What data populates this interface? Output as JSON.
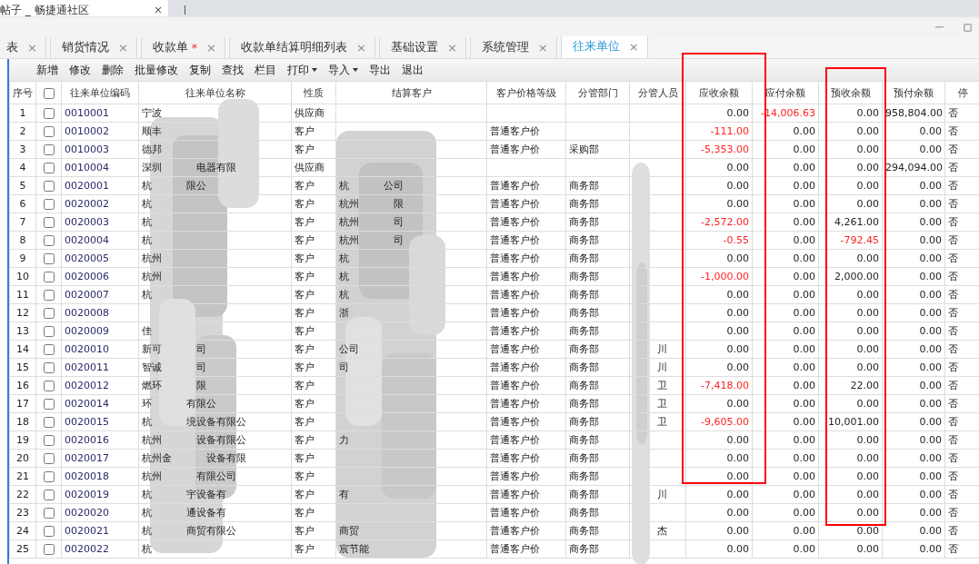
{
  "browser_tab": {
    "title": "帖子 _ 畅捷通社区",
    "close": "×"
  },
  "tabs": [
    {
      "label": "表",
      "selected": false,
      "modified": false
    },
    {
      "label": "销货情况",
      "selected": false,
      "modified": false
    },
    {
      "label": "收款单",
      "selected": false,
      "modified": true
    },
    {
      "label": "收款单结算明细列表",
      "selected": false,
      "modified": false
    },
    {
      "label": "基础设置",
      "selected": false,
      "modified": false
    },
    {
      "label": "系统管理",
      "selected": false,
      "modified": false
    },
    {
      "label": "往来单位",
      "selected": true,
      "modified": false
    }
  ],
  "tab_close": "×",
  "modified_mark": "*",
  "toolbar": [
    {
      "label": "新增",
      "dropdown": false
    },
    {
      "label": "修改",
      "dropdown": false
    },
    {
      "label": "删除",
      "dropdown": false
    },
    {
      "label": "批量修改",
      "dropdown": false
    },
    {
      "label": "复制",
      "dropdown": false
    },
    {
      "label": "查找",
      "dropdown": false
    },
    {
      "label": "栏目",
      "dropdown": false
    },
    {
      "label": "打印",
      "dropdown": true
    },
    {
      "label": "导入",
      "dropdown": true
    },
    {
      "label": "导出",
      "dropdown": false
    },
    {
      "label": "退出",
      "dropdown": false
    }
  ],
  "table": {
    "columns": [
      {
        "label": "序号",
        "kind": "seq",
        "highlighted": false
      },
      {
        "kind": "check",
        "checked": false,
        "highlighted": false
      },
      {
        "label": "往来单位编码",
        "kind": "code",
        "highlighted": false
      },
      {
        "label": "往来单位名称",
        "kind": "text",
        "highlighted": false
      },
      {
        "label": "性质",
        "kind": "text",
        "highlighted": false
      },
      {
        "label": "结算客户",
        "kind": "text",
        "highlighted": false
      },
      {
        "label": "客户价格等级",
        "kind": "text",
        "highlighted": false
      },
      {
        "label": "分管部门",
        "kind": "text",
        "highlighted": false
      },
      {
        "label": "分管人员",
        "kind": "text",
        "highlighted": false
      },
      {
        "label": "应收余额",
        "kind": "amount",
        "highlighted": true
      },
      {
        "label": "应付余额",
        "kind": "amount",
        "highlighted": false
      },
      {
        "label": "预收余额",
        "kind": "amount",
        "highlighted": true
      },
      {
        "label": "预付余额",
        "kind": "amount",
        "highlighted": false
      },
      {
        "label": "停",
        "kind": "text",
        "highlighted": false
      }
    ],
    "rows": [
      {
        "seq": "1",
        "checked": false,
        "code": "0010001",
        "name": [
          "宁波"
        ],
        "type": "供应商",
        "settle": [],
        "price": "",
        "dept": "",
        "person": [],
        "amounts": [
          {
            "value": "0.00",
            "negative": false
          },
          {
            "value": "-14,006.63",
            "negative": true
          },
          {
            "value": "0.00",
            "negative": false
          },
          {
            "value": "958,804.00",
            "negative": false
          }
        ],
        "disabled": "否"
      },
      {
        "seq": "2",
        "checked": false,
        "code": "0010002",
        "name": [
          "顺丰"
        ],
        "type": "客户",
        "settle": [],
        "price": "普通客户价",
        "dept": "",
        "person": [],
        "amounts": [
          {
            "value": "-111.00",
            "negative": true
          },
          {
            "value": "0.00",
            "negative": false
          },
          {
            "value": "0.00",
            "negative": false
          },
          {
            "value": "0.00",
            "negative": false
          }
        ],
        "disabled": "否"
      },
      {
        "seq": "3",
        "checked": false,
        "code": "0010003",
        "name": [
          "德邦"
        ],
        "type": "客户",
        "settle": [],
        "price": "普通客户价",
        "dept": "采购部",
        "person": [],
        "amounts": [
          {
            "value": "-5,353.00",
            "negative": true
          },
          {
            "value": "0.00",
            "negative": false
          },
          {
            "value": "0.00",
            "negative": false
          },
          {
            "value": "0.00",
            "negative": false
          }
        ],
        "disabled": "否"
      },
      {
        "seq": "4",
        "checked": false,
        "code": "0010004",
        "name": [
          "深圳",
          "电器有限"
        ],
        "type": "供应商",
        "settle": [],
        "price": "",
        "dept": "",
        "person": [],
        "amounts": [
          {
            "value": "0.00",
            "negative": false
          },
          {
            "value": "0.00",
            "negative": false
          },
          {
            "value": "0.00",
            "negative": false
          },
          {
            "value": "294,094.00",
            "negative": false
          }
        ],
        "disabled": "否"
      },
      {
        "seq": "5",
        "checked": false,
        "code": "0020001",
        "name": [
          "杭",
          "限公"
        ],
        "type": "客户",
        "settle": [
          "杭",
          "公司"
        ],
        "price": "普通客户价",
        "dept": "商务部",
        "person": [],
        "amounts": [
          {
            "value": "0.00",
            "negative": false
          },
          {
            "value": "0.00",
            "negative": false
          },
          {
            "value": "0.00",
            "negative": false
          },
          {
            "value": "0.00",
            "negative": false
          }
        ],
        "disabled": "否"
      },
      {
        "seq": "6",
        "checked": false,
        "code": "0020002",
        "name": [
          "杭"
        ],
        "type": "客户",
        "settle": [
          "杭州",
          "限"
        ],
        "price": "普通客户价",
        "dept": "商务部",
        "person": [],
        "amounts": [
          {
            "value": "0.00",
            "negative": false
          },
          {
            "value": "0.00",
            "negative": false
          },
          {
            "value": "0.00",
            "negative": false
          },
          {
            "value": "0.00",
            "negative": false
          }
        ],
        "disabled": "否"
      },
      {
        "seq": "7",
        "checked": false,
        "code": "0020003",
        "name": [
          "杭"
        ],
        "type": "客户",
        "settle": [
          "杭州",
          "司"
        ],
        "price": "普通客户价",
        "dept": "商务部",
        "person": [],
        "amounts": [
          {
            "value": "-2,572.00",
            "negative": true
          },
          {
            "value": "0.00",
            "negative": false
          },
          {
            "value": "4,261.00",
            "negative": false
          },
          {
            "value": "0.00",
            "negative": false
          }
        ],
        "disabled": "否"
      },
      {
        "seq": "8",
        "checked": false,
        "code": "0020004",
        "name": [
          "杭"
        ],
        "type": "客户",
        "settle": [
          "杭州",
          "司"
        ],
        "price": "普通客户价",
        "dept": "商务部",
        "person": [],
        "amounts": [
          {
            "value": "-0.55",
            "negative": true
          },
          {
            "value": "0.00",
            "negative": false
          },
          {
            "value": "-792.45",
            "negative": true
          },
          {
            "value": "0.00",
            "negative": false
          }
        ],
        "disabled": "否"
      },
      {
        "seq": "9",
        "checked": false,
        "code": "0020005",
        "name": [
          "杭州"
        ],
        "type": "客户",
        "settle": [
          "杭"
        ],
        "price": "普通客户价",
        "dept": "商务部",
        "person": [],
        "amounts": [
          {
            "value": "0.00",
            "negative": false
          },
          {
            "value": "0.00",
            "negative": false
          },
          {
            "value": "0.00",
            "negative": false
          },
          {
            "value": "0.00",
            "negative": false
          }
        ],
        "disabled": "否"
      },
      {
        "seq": "10",
        "checked": false,
        "code": "0020006",
        "name": [
          "杭州"
        ],
        "type": "客户",
        "settle": [
          "杭"
        ],
        "price": "普通客户价",
        "dept": "商务部",
        "person": [],
        "amounts": [
          {
            "value": "-1,000.00",
            "negative": true
          },
          {
            "value": "0.00",
            "negative": false
          },
          {
            "value": "2,000.00",
            "negative": false
          },
          {
            "value": "0.00",
            "negative": false
          }
        ],
        "disabled": "否"
      },
      {
        "seq": "11",
        "checked": false,
        "code": "0020007",
        "name": [
          "杭"
        ],
        "type": "客户",
        "settle": [
          "杭"
        ],
        "price": "普通客户价",
        "dept": "商务部",
        "person": [],
        "amounts": [
          {
            "value": "0.00",
            "negative": false
          },
          {
            "value": "0.00",
            "negative": false
          },
          {
            "value": "0.00",
            "negative": false
          },
          {
            "value": "0.00",
            "negative": false
          }
        ],
        "disabled": "否"
      },
      {
        "seq": "12",
        "checked": false,
        "code": "0020008",
        "name": [],
        "type": "客户",
        "settle": [
          "浙"
        ],
        "price": "普通客户价",
        "dept": "商务部",
        "person": [],
        "amounts": [
          {
            "value": "0.00",
            "negative": false
          },
          {
            "value": "0.00",
            "negative": false
          },
          {
            "value": "0.00",
            "negative": false
          },
          {
            "value": "0.00",
            "negative": false
          }
        ],
        "disabled": "否"
      },
      {
        "seq": "13",
        "checked": false,
        "code": "0020009",
        "name": [
          "佳"
        ],
        "type": "客户",
        "settle": [],
        "price": "普通客户价",
        "dept": "商务部",
        "person": [],
        "amounts": [
          {
            "value": "0.00",
            "negative": false
          },
          {
            "value": "0.00",
            "negative": false
          },
          {
            "value": "0.00",
            "negative": false
          },
          {
            "value": "0.00",
            "negative": false
          }
        ],
        "disabled": "否"
      },
      {
        "seq": "14",
        "checked": false,
        "code": "0020010",
        "name": [
          "新可",
          "司"
        ],
        "type": "客户",
        "settle": [
          "公司"
        ],
        "price": "普通客户价",
        "dept": "商务部",
        "person": [
          "川"
        ],
        "amounts": [
          {
            "value": "0.00",
            "negative": false
          },
          {
            "value": "0.00",
            "negative": false
          },
          {
            "value": "0.00",
            "negative": false
          },
          {
            "value": "0.00",
            "negative": false
          }
        ],
        "disabled": "否"
      },
      {
        "seq": "15",
        "checked": false,
        "code": "0020011",
        "name": [
          "智诚",
          "司"
        ],
        "type": "客户",
        "settle": [
          "司"
        ],
        "price": "普通客户价",
        "dept": "商务部",
        "person": [
          "川"
        ],
        "amounts": [
          {
            "value": "0.00",
            "negative": false
          },
          {
            "value": "0.00",
            "negative": false
          },
          {
            "value": "0.00",
            "negative": false
          },
          {
            "value": "0.00",
            "negative": false
          }
        ],
        "disabled": "否"
      },
      {
        "seq": "16",
        "checked": false,
        "code": "0020012",
        "name": [
          "燃环",
          "限"
        ],
        "type": "客户",
        "settle": [],
        "price": "普通客户价",
        "dept": "商务部",
        "person": [
          "卫"
        ],
        "amounts": [
          {
            "value": "-7,418.00",
            "negative": true
          },
          {
            "value": "0.00",
            "negative": false
          },
          {
            "value": "22.00",
            "negative": false
          },
          {
            "value": "0.00",
            "negative": false
          }
        ],
        "disabled": "否"
      },
      {
        "seq": "17",
        "checked": false,
        "code": "0020014",
        "name": [
          "环",
          "有限公"
        ],
        "type": "客户",
        "settle": [],
        "price": "普通客户价",
        "dept": "商务部",
        "person": [
          "卫"
        ],
        "amounts": [
          {
            "value": "0.00",
            "negative": false
          },
          {
            "value": "0.00",
            "negative": false
          },
          {
            "value": "0.00",
            "negative": false
          },
          {
            "value": "0.00",
            "negative": false
          }
        ],
        "disabled": "否"
      },
      {
        "seq": "18",
        "checked": false,
        "code": "0020015",
        "name": [
          "杭",
          "境设备有限公"
        ],
        "type": "客户",
        "settle": [],
        "price": "普通客户价",
        "dept": "商务部",
        "person": [
          "卫"
        ],
        "amounts": [
          {
            "value": "-9,605.00",
            "negative": true
          },
          {
            "value": "0.00",
            "negative": false
          },
          {
            "value": "10,001.00",
            "negative": false
          },
          {
            "value": "0.00",
            "negative": false
          }
        ],
        "disabled": "否"
      },
      {
        "seq": "19",
        "checked": false,
        "code": "0020016",
        "name": [
          "杭州",
          "设备有限公"
        ],
        "type": "客户",
        "settle": [
          "力"
        ],
        "price": "普通客户价",
        "dept": "商务部",
        "person": [],
        "amounts": [
          {
            "value": "0.00",
            "negative": false
          },
          {
            "value": "0.00",
            "negative": false
          },
          {
            "value": "0.00",
            "negative": false
          },
          {
            "value": "0.00",
            "negative": false
          }
        ],
        "disabled": "否"
      },
      {
        "seq": "20",
        "checked": false,
        "code": "0020017",
        "name": [
          "杭州金",
          "设备有限"
        ],
        "type": "客户",
        "settle": [],
        "price": "普通客户价",
        "dept": "商务部",
        "person": [],
        "amounts": [
          {
            "value": "0.00",
            "negative": false
          },
          {
            "value": "0.00",
            "negative": false
          },
          {
            "value": "0.00",
            "negative": false
          },
          {
            "value": "0.00",
            "negative": false
          }
        ],
        "disabled": "否"
      },
      {
        "seq": "21",
        "checked": false,
        "code": "0020018",
        "name": [
          "杭州",
          "有限公司"
        ],
        "type": "客户",
        "settle": [],
        "price": "普通客户价",
        "dept": "商务部",
        "person": [],
        "amounts": [
          {
            "value": "0.00",
            "negative": false
          },
          {
            "value": "0.00",
            "negative": false
          },
          {
            "value": "0.00",
            "negative": false
          },
          {
            "value": "0.00",
            "negative": false
          }
        ],
        "disabled": "否"
      },
      {
        "seq": "22",
        "checked": false,
        "code": "0020019",
        "name": [
          "杭",
          "宇设备有"
        ],
        "type": "客户",
        "settle": [
          "有"
        ],
        "price": "普通客户价",
        "dept": "商务部",
        "person": [
          "川"
        ],
        "amounts": [
          {
            "value": "0.00",
            "negative": false
          },
          {
            "value": "0.00",
            "negative": false
          },
          {
            "value": "0.00",
            "negative": false
          },
          {
            "value": "0.00",
            "negative": false
          }
        ],
        "disabled": "否"
      },
      {
        "seq": "23",
        "checked": false,
        "code": "0020020",
        "name": [
          "杭",
          "通设备有"
        ],
        "type": "客户",
        "settle": [],
        "price": "普通客户价",
        "dept": "商务部",
        "person": [],
        "amounts": [
          {
            "value": "0.00",
            "negative": false
          },
          {
            "value": "0.00",
            "negative": false
          },
          {
            "value": "0.00",
            "negative": false
          },
          {
            "value": "0.00",
            "negative": false
          }
        ],
        "disabled": "否"
      },
      {
        "seq": "24",
        "checked": false,
        "code": "0020021",
        "name": [
          "杭",
          "商贸有限公"
        ],
        "type": "客户",
        "settle": [
          "商贸"
        ],
        "price": "普通客户价",
        "dept": "商务部",
        "person": [
          "杰"
        ],
        "amounts": [
          {
            "value": "0.00",
            "negative": false
          },
          {
            "value": "0.00",
            "negative": false
          },
          {
            "value": "0.00",
            "negative": false
          },
          {
            "value": "0.00",
            "negative": false
          }
        ],
        "disabled": "否"
      },
      {
        "seq": "25",
        "checked": false,
        "code": "0020022",
        "name": [
          "杭"
        ],
        "type": "客户",
        "settle": [
          "宸节能"
        ],
        "price": "普通客户价",
        "dept": "商务部",
        "person": [],
        "amounts": [
          {
            "value": "0.00",
            "negative": false
          },
          {
            "value": "0.00",
            "negative": false
          },
          {
            "value": "0.00",
            "negative": false
          },
          {
            "value": "0.00",
            "negative": false
          }
        ],
        "disabled": "否"
      }
    ]
  }
}
